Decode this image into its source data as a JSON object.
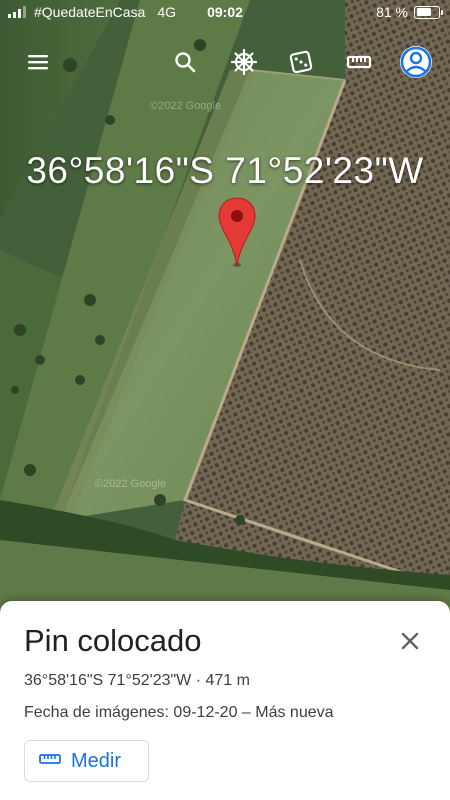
{
  "status_bar": {
    "carrier": "#QuedateEnCasa",
    "network": "4G",
    "time": "09:02",
    "battery_text": "81 %",
    "battery_level": 0.81
  },
  "toolbar": {
    "icons": [
      "menu-icon",
      "search-icon",
      "voyager-icon",
      "dice-icon",
      "ruler-icon",
      "account-icon"
    ]
  },
  "map": {
    "coordinates_overlay": "36°58'16\"S 71°52'23\"W",
    "watermark": "©2022 Google"
  },
  "sheet": {
    "title": "Pin colocado",
    "location_line": "36°58'16\"S 71°52'23\"W · 471 m",
    "imagery_date_line": "Fecha de imágenes: 09-12-20 – Más nueva",
    "measure_label": "Medir"
  },
  "colors": {
    "accent": "#1a73e8",
    "pin": "#e53935",
    "sheet_bg": "#ffffff"
  }
}
